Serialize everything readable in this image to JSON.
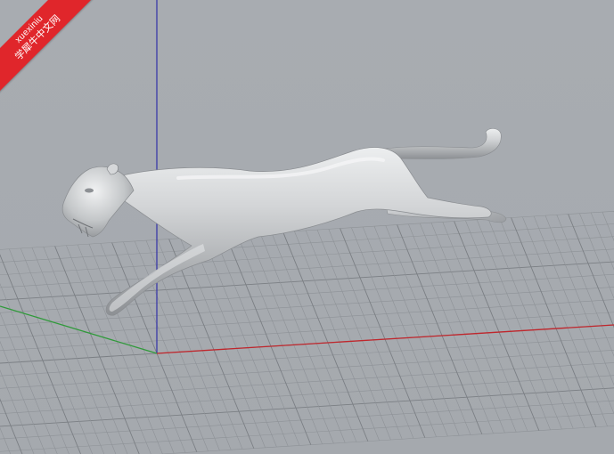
{
  "viewport": {
    "background_color": "#a7abb0",
    "grid_color": "#8e9297",
    "grid_major_color": "#7b7f84",
    "axis_x_color": "#c0262c",
    "axis_y_color": "#2f9a3a",
    "axis_z_color": "#3a3aa8",
    "model_name": "cheetah-icon",
    "model_color": "#c9cbcd"
  },
  "watermark": {
    "site": "xuexiniu",
    "brand": "学犀牛中文网",
    "color": "#e0262b"
  }
}
